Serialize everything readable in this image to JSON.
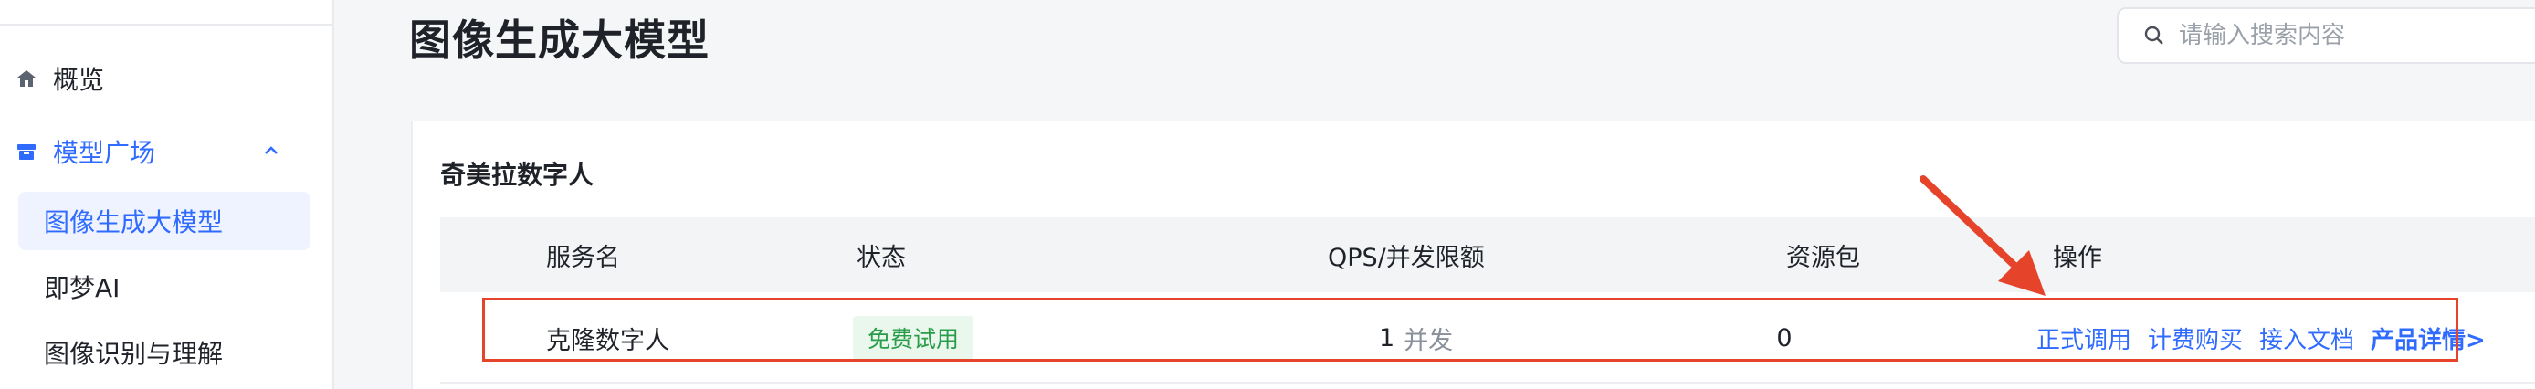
{
  "sidebar": {
    "items": [
      {
        "label": "概览",
        "icon": "home-icon"
      },
      {
        "label": "模型广场",
        "icon": "box-icon",
        "expanded": true,
        "chevron": "chevron-up-icon"
      }
    ],
    "subitems": [
      {
        "label": "图像生成大模型",
        "active": true
      },
      {
        "label": "即梦AI"
      },
      {
        "label": "图像识别与理解"
      }
    ]
  },
  "header": {
    "title": "图像生成大模型",
    "search_placeholder": "请输入搜索内容",
    "search_icon": "search-icon"
  },
  "card": {
    "title": "奇美拉数字人",
    "columns": [
      "服务名",
      "状态",
      "QPS/并发限额",
      "资源包",
      "操作"
    ],
    "rows": [
      {
        "name": "克隆数字人",
        "status": "免费试用",
        "qps_value": "1",
        "qps_unit": "并发",
        "package": "0",
        "actions": [
          "正式调用",
          "计费购买",
          "接入文档",
          "产品详情>"
        ]
      }
    ]
  },
  "colors": {
    "accent": "#2f6bff",
    "badge_bg": "#e9f7ec",
    "badge_text": "#2a9d4b",
    "annotation": "#e5442b"
  }
}
